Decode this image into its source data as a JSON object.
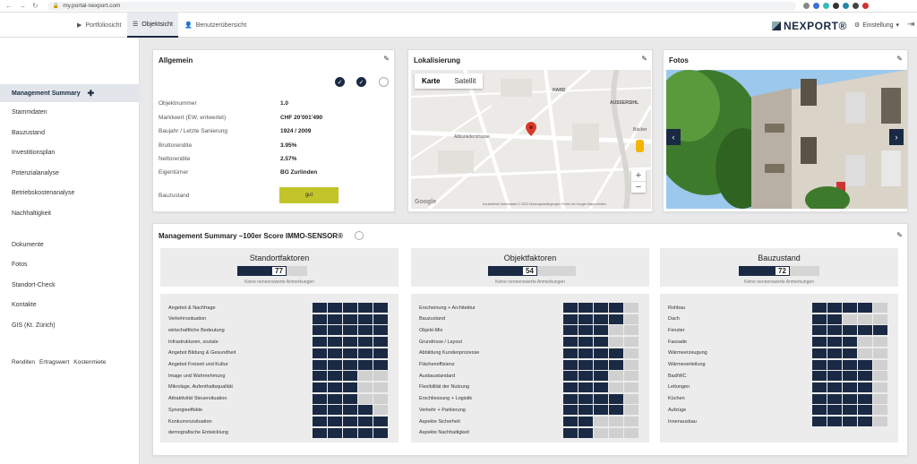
{
  "browser": {
    "url": "my.portal-nexport.com"
  },
  "topnav": {
    "tabs": [
      {
        "label": "Portfoliosicht"
      },
      {
        "label": "Objektsicht"
      },
      {
        "label": "Benutzerübersicht"
      }
    ],
    "brand": "NEXPORT®",
    "settings_label": "Einstellung"
  },
  "sidebar": {
    "active": "Management Summary",
    "items": [
      "Stammdaten",
      "Bauzustand",
      "Investitionsplan",
      "Potenzialanalyse",
      "Betriebskostenanalyse",
      "Nachhaltigkeit"
    ],
    "items2": [
      "Dokumente",
      "Fotos",
      "Standort-Check",
      "Kontakte",
      "GIS (Kt. Zürich)"
    ],
    "links": [
      "Renditen",
      "Ertragswert",
      "Kostenmiete"
    ]
  },
  "allgemein": {
    "title": "Allgemein",
    "rows": [
      {
        "label": "Objektnummer",
        "value": "1.0"
      },
      {
        "label": "Marktwert (EW, entwertet)",
        "value": "CHF 20'001'490"
      },
      {
        "label": "Baujahr / Letzte Sanierung",
        "value": "1924 / 2009"
      },
      {
        "label": "Bruttorendite",
        "value": "3.95%"
      },
      {
        "label": "Nettorendite",
        "value": "2.57%"
      },
      {
        "label": "Eigentümer",
        "value": "BG Zurlinden"
      }
    ],
    "bauzustand_label": "Bauzustand",
    "bauzustand_value": "gut"
  },
  "lokalisierung": {
    "title": "Lokalisierung",
    "btn_map": "Karte",
    "btn_sat": "Satellit",
    "streets": [
      "HARD",
      "Albisriederstrasse",
      "Bäcker",
      "AUSSERSIHL"
    ],
    "footer": "Kurzbefehle   Kartendaten © 2022   Nutzungsbedingungen   Fehler bei Google Maps melden",
    "google": "Google"
  },
  "fotos": {
    "title": "Fotos"
  },
  "summary": {
    "title": "Management Summary –100er Score IMMO-SENSOR®",
    "note": "Keine nennenswerte Anmerkungen",
    "groups": [
      {
        "title": "Standortfaktoren",
        "score": "77",
        "rows": [
          {
            "label": "Angebot & Nachfrage",
            "level": 5
          },
          {
            "label": "Verkehrssituation",
            "level": 5
          },
          {
            "label": "wirtschaftliche Bedeutung",
            "level": 5
          },
          {
            "label": "Infrastrukturen, soziale",
            "level": 5
          },
          {
            "label": "Angebot Bildung & Gesundheit",
            "level": 5
          },
          {
            "label": "Angebot Freizeit und Kultur",
            "level": 5
          },
          {
            "label": "Image und Wahrnehmung",
            "level": 3
          },
          {
            "label": "Mikrolage, Aufenthaltsqualität",
            "level": 3
          },
          {
            "label": "Attraktivität Steuersituation",
            "level": 3
          },
          {
            "label": "Synergieeffekte",
            "level": 4
          },
          {
            "label": "Konkurrenzsituation",
            "level": 5
          },
          {
            "label": "demografische Entwicklung",
            "level": 5
          }
        ]
      },
      {
        "title": "Objektfaktoren",
        "score": "54",
        "rows": [
          {
            "label": "Erscheinung + Architektur",
            "level": 4
          },
          {
            "label": "Bauzustand",
            "level": 4
          },
          {
            "label": "Objekt-Mix",
            "level": 3
          },
          {
            "label": "Grundrisse / Layout",
            "level": 3
          },
          {
            "label": "Abbildung Kundenprozesse",
            "level": 4
          },
          {
            "label": "Flächeneffizienz",
            "level": 4
          },
          {
            "label": "Ausbaustandard",
            "level": 3
          },
          {
            "label": "Flexibilität der Nutzung",
            "level": 3
          },
          {
            "label": "Erschliessung + Logistik",
            "level": 4
          },
          {
            "label": "Verkehr + Parkierung",
            "level": 4
          },
          {
            "label": "Aspekte Sicherheit",
            "level": 2
          },
          {
            "label": "Aspekte Nachhaltigkeit",
            "level": 2
          }
        ]
      },
      {
        "title": "Bauzustand",
        "score": "72",
        "rows": [
          {
            "label": "Rohbau",
            "level": 4
          },
          {
            "label": "Dach",
            "level": 2
          },
          {
            "label": "Fenster",
            "level": 5
          },
          {
            "label": "Fassade",
            "level": 3
          },
          {
            "label": "Wärmeerzeugung",
            "level": 3
          },
          {
            "label": "Wärmeverteilung",
            "level": 4
          },
          {
            "label": "Bad/WC",
            "level": 4
          },
          {
            "label": "Leitungen",
            "level": 4
          },
          {
            "label": "Küchen",
            "level": 4
          },
          {
            "label": "Aufzüge",
            "level": 4
          },
          {
            "label": "Innenausbau",
            "level": 4
          }
        ]
      }
    ]
  },
  "colors": {
    "navy": "#1a2a44",
    "ok": "#c2c42a"
  }
}
